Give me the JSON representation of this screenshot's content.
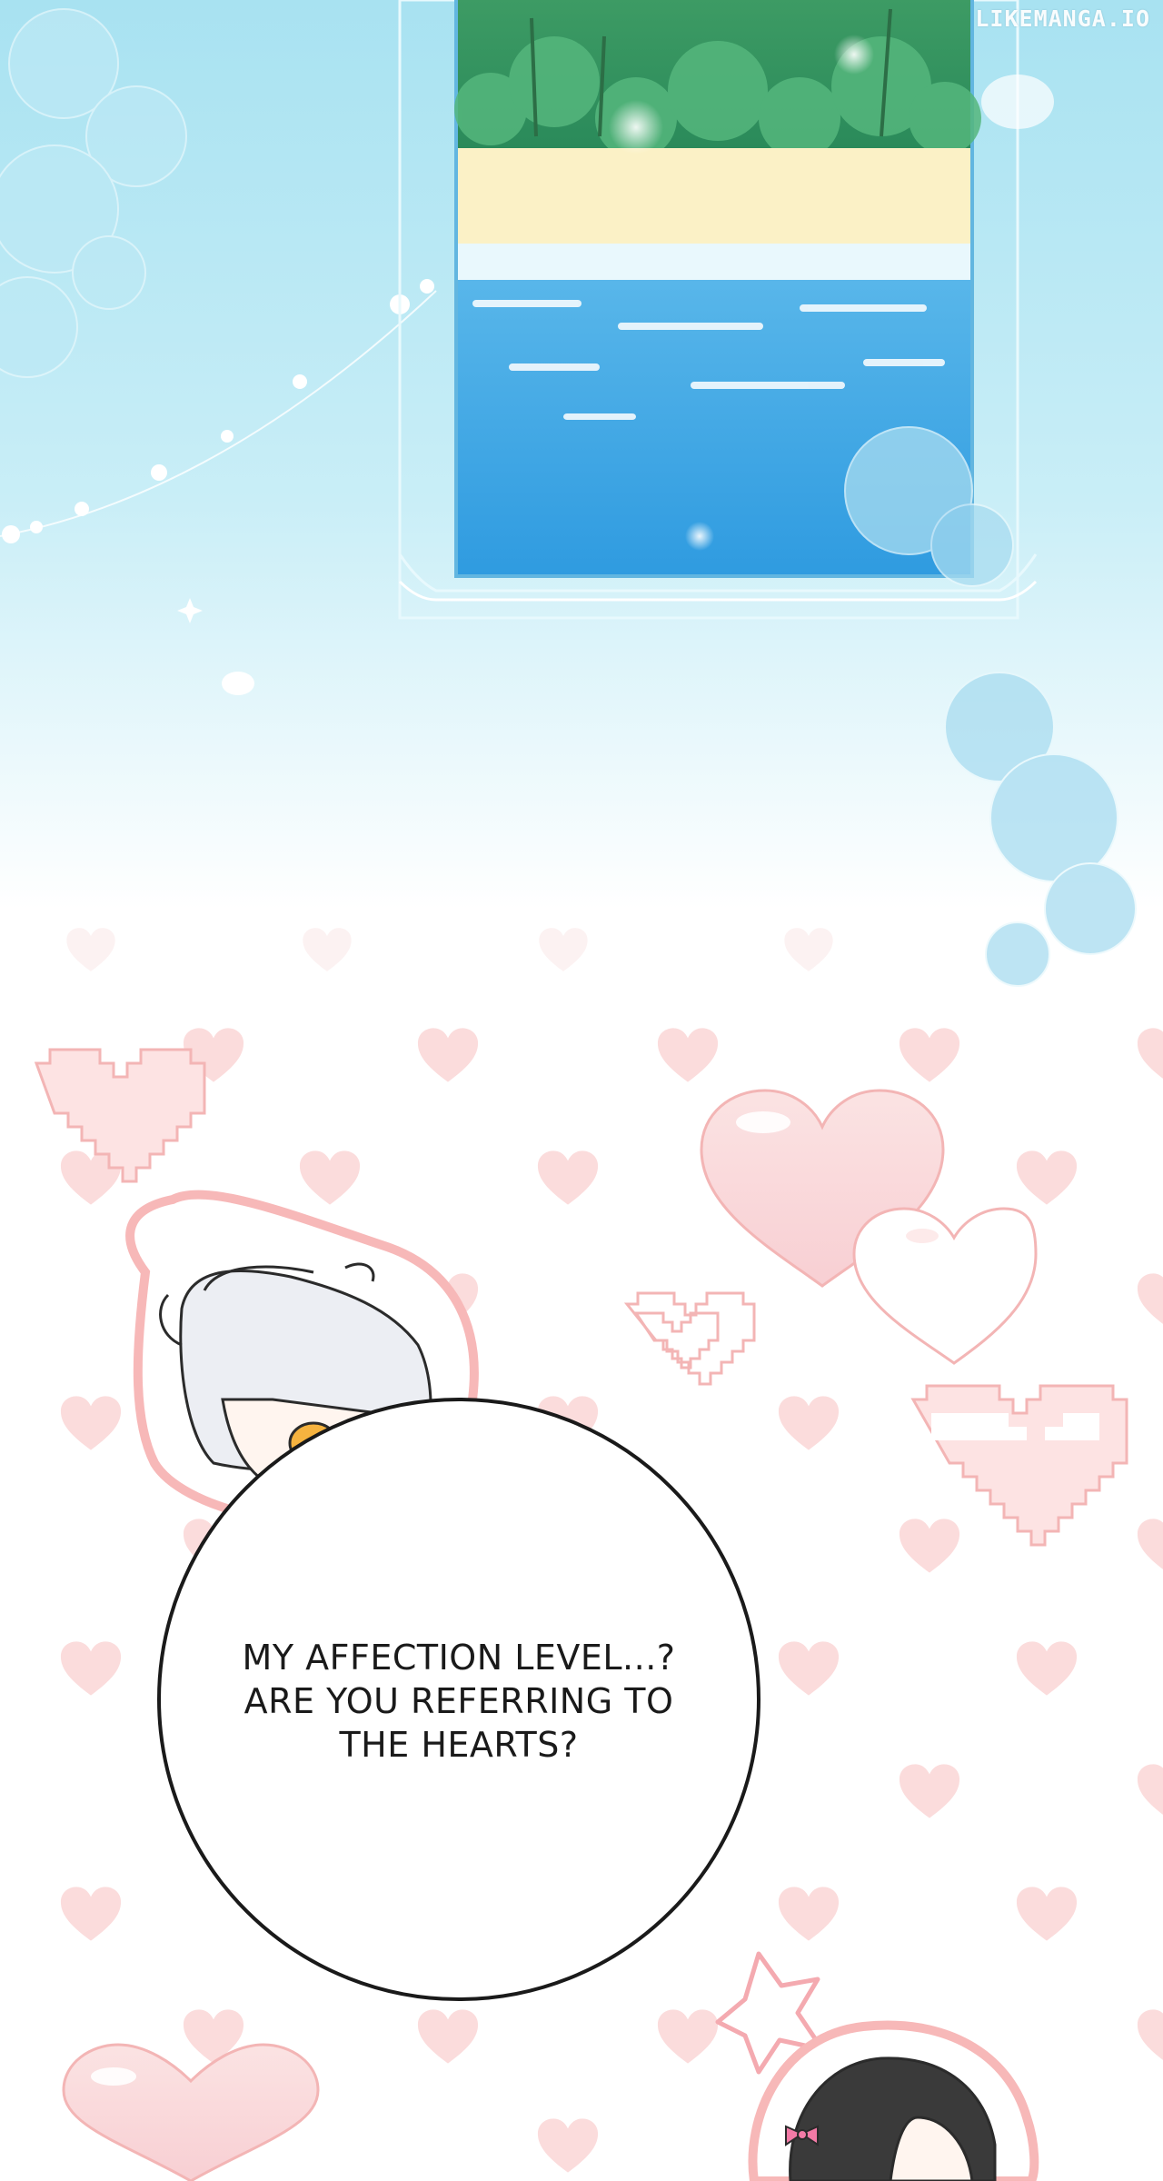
{
  "watermark": "LIKEMANGA.IO",
  "dialogue": {
    "lines": [
      "MY AFFECTION LEVEL...?",
      "ARE YOU REFERRING TO",
      "THE HEARTS?"
    ]
  },
  "colors": {
    "sky_top": "#a9e3f2",
    "sky_bottom": "#ffffff",
    "heart_pink": "#fbdcdc",
    "heart_outline": "#f3b5b5",
    "frame_border": "#62b6e0",
    "sea": "#4fb0ea",
    "sand": "#fbf1c6"
  },
  "icons": [
    "heart-icon",
    "pixel-heart-icon",
    "sparkle-icon",
    "anger-mark-icon"
  ]
}
